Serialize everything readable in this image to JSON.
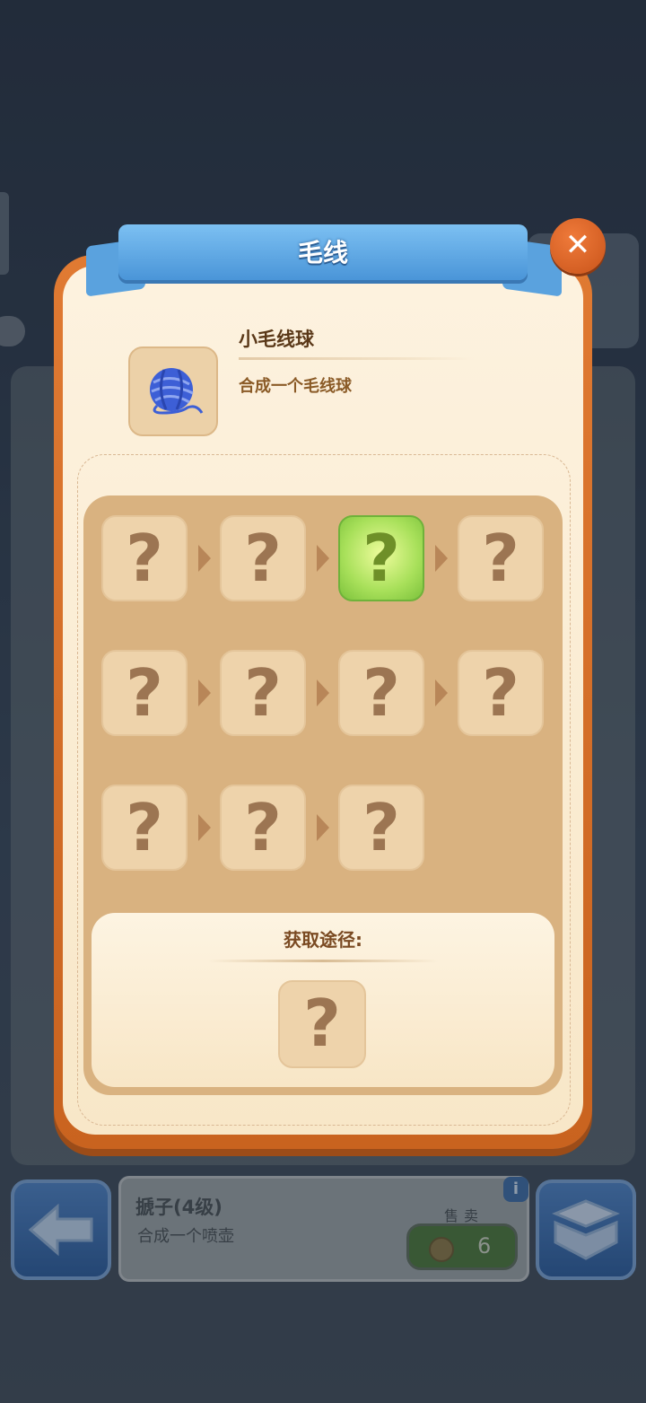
{
  "modal": {
    "title": "毛线",
    "close_glyph": "✕",
    "item": {
      "icon": "yarn-ball-icon",
      "name": "小毛线球",
      "description": "合成一个毛线球"
    },
    "chain": {
      "rows": [
        [
          "?",
          "?",
          "?",
          "?"
        ],
        [
          "?",
          "?",
          "?",
          "?"
        ],
        [
          "?",
          "?",
          "?"
        ]
      ],
      "active_index": 2
    },
    "source": {
      "title": "获取途径:",
      "unknown_glyph": "?"
    }
  },
  "bottom_bar": {
    "back_icon": "back-arrow-icon",
    "selected_item": {
      "name": "搋子(4级)",
      "description": "合成一个喷壶",
      "info_glyph": "i"
    },
    "sell": {
      "label": "售卖",
      "price": "6"
    },
    "inventory_icon": "storage-box-icon"
  },
  "colors": {
    "modal_frame": "#e07a32",
    "modal_bg": "#fdf2df",
    "ribbon": "#4a95d8",
    "active_tile": "#a8e05a",
    "tile": "#eed3ab",
    "panel": "#d9b280"
  }
}
